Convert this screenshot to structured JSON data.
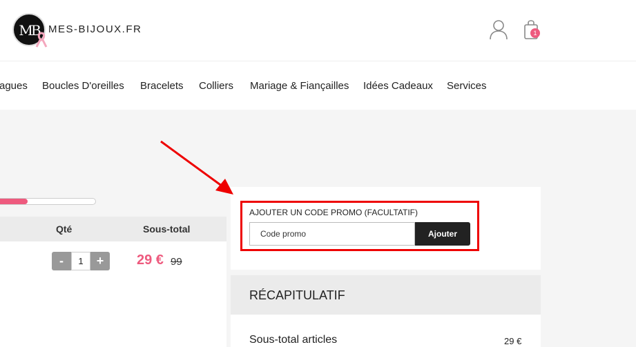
{
  "header": {
    "logo_monogram": "MB",
    "logo_text": "MES-BIJOUX.FR",
    "cart_count": "1"
  },
  "nav": {
    "items": [
      "agues",
      "Boucles D'oreilles",
      "Bracelets",
      "Colliers",
      "Mariage & Fiançailles",
      "Idées Cadeaux",
      "Services"
    ]
  },
  "cart": {
    "progress_fraction": 0.33,
    "columns": {
      "qty": "Qté",
      "subtotal": "Sous-total"
    },
    "item": {
      "qty_minus": "-",
      "qty": "1",
      "qty_plus": "+",
      "price": "29 €",
      "old_price": "99"
    }
  },
  "promo": {
    "label": "AJOUTER UN CODE PROMO (FACULTATIF)",
    "placeholder": "Code promo",
    "button": "Ajouter"
  },
  "summary": {
    "title": "RÉCAPITULATIF",
    "subtotal_label": "Sous-total articles",
    "subtotal_value": "29 €"
  },
  "colors": {
    "accent_pink": "#ee5a7e",
    "annotation_red": "#e00000",
    "button_dark": "#222222"
  },
  "icons": [
    "user-icon",
    "shopping-bag-icon",
    "ribbon-icon",
    "annotation-arrow"
  ]
}
